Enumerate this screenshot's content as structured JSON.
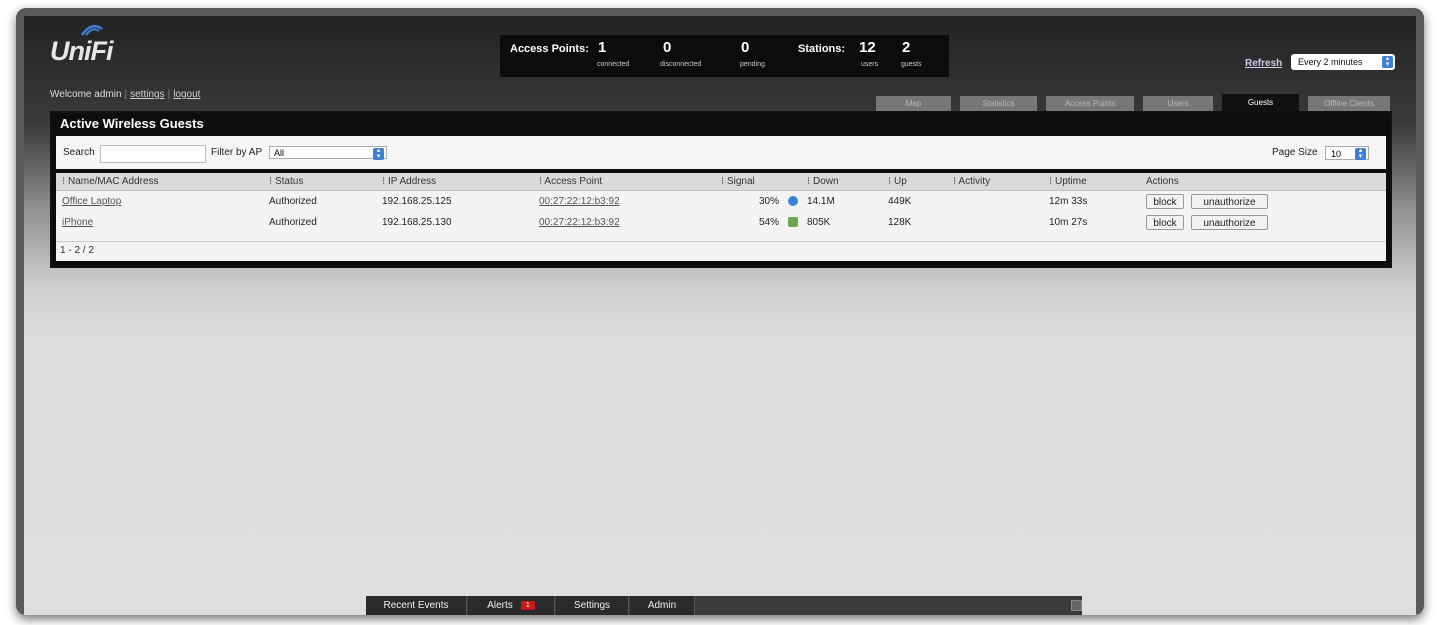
{
  "app": {
    "logo": "UniFi"
  },
  "user": {
    "welcome": "Welcome admin",
    "settings": "settings",
    "logout": "logout"
  },
  "stats": {
    "access_points_label": "Access Points:",
    "connected": "1",
    "connected_label": "connected",
    "disconnected": "0",
    "disconnected_label": "disconnected",
    "pending": "0",
    "pending_label": "pending",
    "stations_label": "Stations:",
    "users": "12",
    "users_label": "users",
    "guests": "2",
    "guests_label": "guests"
  },
  "refresh": {
    "label": "Refresh",
    "value": "Every 2 minutes"
  },
  "tabs": [
    "Map",
    "Statistics",
    "Access Points",
    "Users",
    "Guests",
    "Offline Clients"
  ],
  "panel": {
    "title": "Active Wireless Guests",
    "search_label": "Search",
    "filter_label": "Filter by AP",
    "filter_value": "All",
    "page_size_label": "Page Size",
    "page_size_value": "10"
  },
  "columns": [
    "Name/MAC Address",
    "Status",
    "IP Address",
    "Access Point",
    "Signal",
    "Down",
    "Up",
    "Activity",
    "Uptime",
    "Actions"
  ],
  "rows": [
    {
      "name": "Office Laptop",
      "status": "Authorized",
      "ip": "192.168.25.125",
      "ap": "00:27:22:12:b3:92",
      "signal": "30%",
      "down": "14.1M",
      "up": "449K",
      "activity": "",
      "uptime": "12m 33s",
      "block": "block",
      "unauthorize": "unauthorize"
    },
    {
      "name": "iPhone",
      "status": "Authorized",
      "ip": "192.168.25.130",
      "ap": "00:27:22:12:b3:92",
      "signal": "54%",
      "down": "805K",
      "up": "128K",
      "activity": "",
      "uptime": "10m 27s",
      "block": "block",
      "unauthorize": "unauthorize"
    }
  ],
  "pager": "1 - 2 / 2",
  "bottom_tabs": {
    "recent_events": "Recent Events",
    "alerts": "Alerts",
    "alerts_count": "1",
    "settings": "Settings",
    "admin": "Admin"
  },
  "colors": {
    "accent": "#3f7ed8",
    "alert": "#c91b1b"
  }
}
